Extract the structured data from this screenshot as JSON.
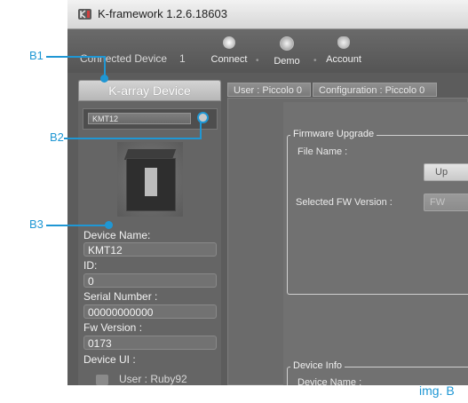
{
  "app": {
    "title": "K-framework 1.2.6.18603"
  },
  "toolbar": {
    "connected_label": "Connected Device",
    "connected_count": "1",
    "buttons": [
      {
        "label": "Connect",
        "icon": "connect-icon"
      },
      {
        "label": "Demo",
        "icon": "demo-icon"
      },
      {
        "label": "Account",
        "icon": "account-icon"
      }
    ]
  },
  "left_panel": {
    "header": "K-array Device",
    "device_chip": "KMT12",
    "fields": [
      {
        "label": "Device Name:",
        "value": "KMT12"
      },
      {
        "label": "ID:",
        "value": "0"
      },
      {
        "label": "Serial Number :",
        "value": "00000000000"
      },
      {
        "label": "Fw Version :",
        "value": "0173"
      }
    ],
    "device_ui_label": "Device UI :",
    "user_text": "User : Ruby92"
  },
  "tabs": [
    {
      "label": "User : Piccolo 0"
    },
    {
      "label": "Configuration : Piccolo 0"
    }
  ],
  "firmware": {
    "title": "Firmware Upgrade",
    "file_name_label": "File Name :",
    "upload_button": "Up",
    "selected_fw_label": "Selected FW Version :",
    "fw_button": "FW"
  },
  "device_info": {
    "title": "Device Info",
    "device_name_label": "Device Name :"
  },
  "annotations": {
    "b1": "B1",
    "b2": "B2",
    "b3": "B3",
    "caption": "img. B"
  },
  "colors": {
    "accent": "#1f97d4",
    "window_bg": "#5c5c5c",
    "panel_bg": "#656565"
  }
}
